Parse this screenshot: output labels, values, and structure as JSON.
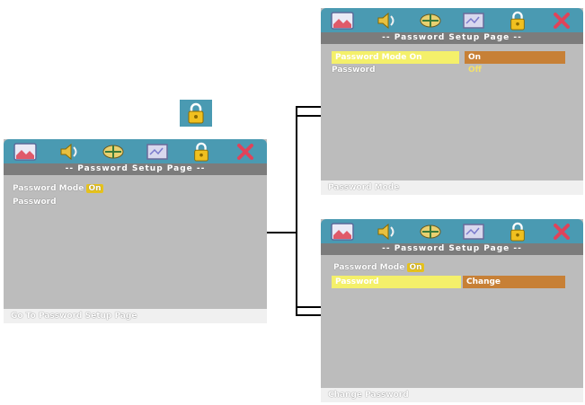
{
  "panel_main": {
    "title": "-- Password Setup Page --",
    "mode_label": "Password  Mode",
    "mode_value": "On",
    "password_label": "Password",
    "status": "Go  To  Password  Setup  Page"
  },
  "panel_mode": {
    "title": "-- Password Setup Page --",
    "mode_label": "Password  Mode On",
    "opt_on": "On",
    "password_label": "Password",
    "opt_off": "Off",
    "status": "Password  Mode"
  },
  "panel_change": {
    "title": "-- Password Setup Page --",
    "mode_label": "Password  Mode",
    "mode_value": "On",
    "password_label": "Password",
    "opt_change": "Change",
    "status": "Change  Password"
  },
  "colors": {
    "icon_bar": "#4a9ab2",
    "title_bar": "#7c7c7c",
    "panel_bg": "#bcbcbc",
    "highlight_label": "#f4f06a",
    "highlight_option": "#c78036",
    "on_value": "#e6c21c",
    "close_icon": "#e0435a"
  },
  "icons": [
    "general-setup-icon",
    "audio-setup-icon",
    "dolby-setup-icon",
    "video-setup-icon",
    "lock-icon",
    "close-icon"
  ]
}
